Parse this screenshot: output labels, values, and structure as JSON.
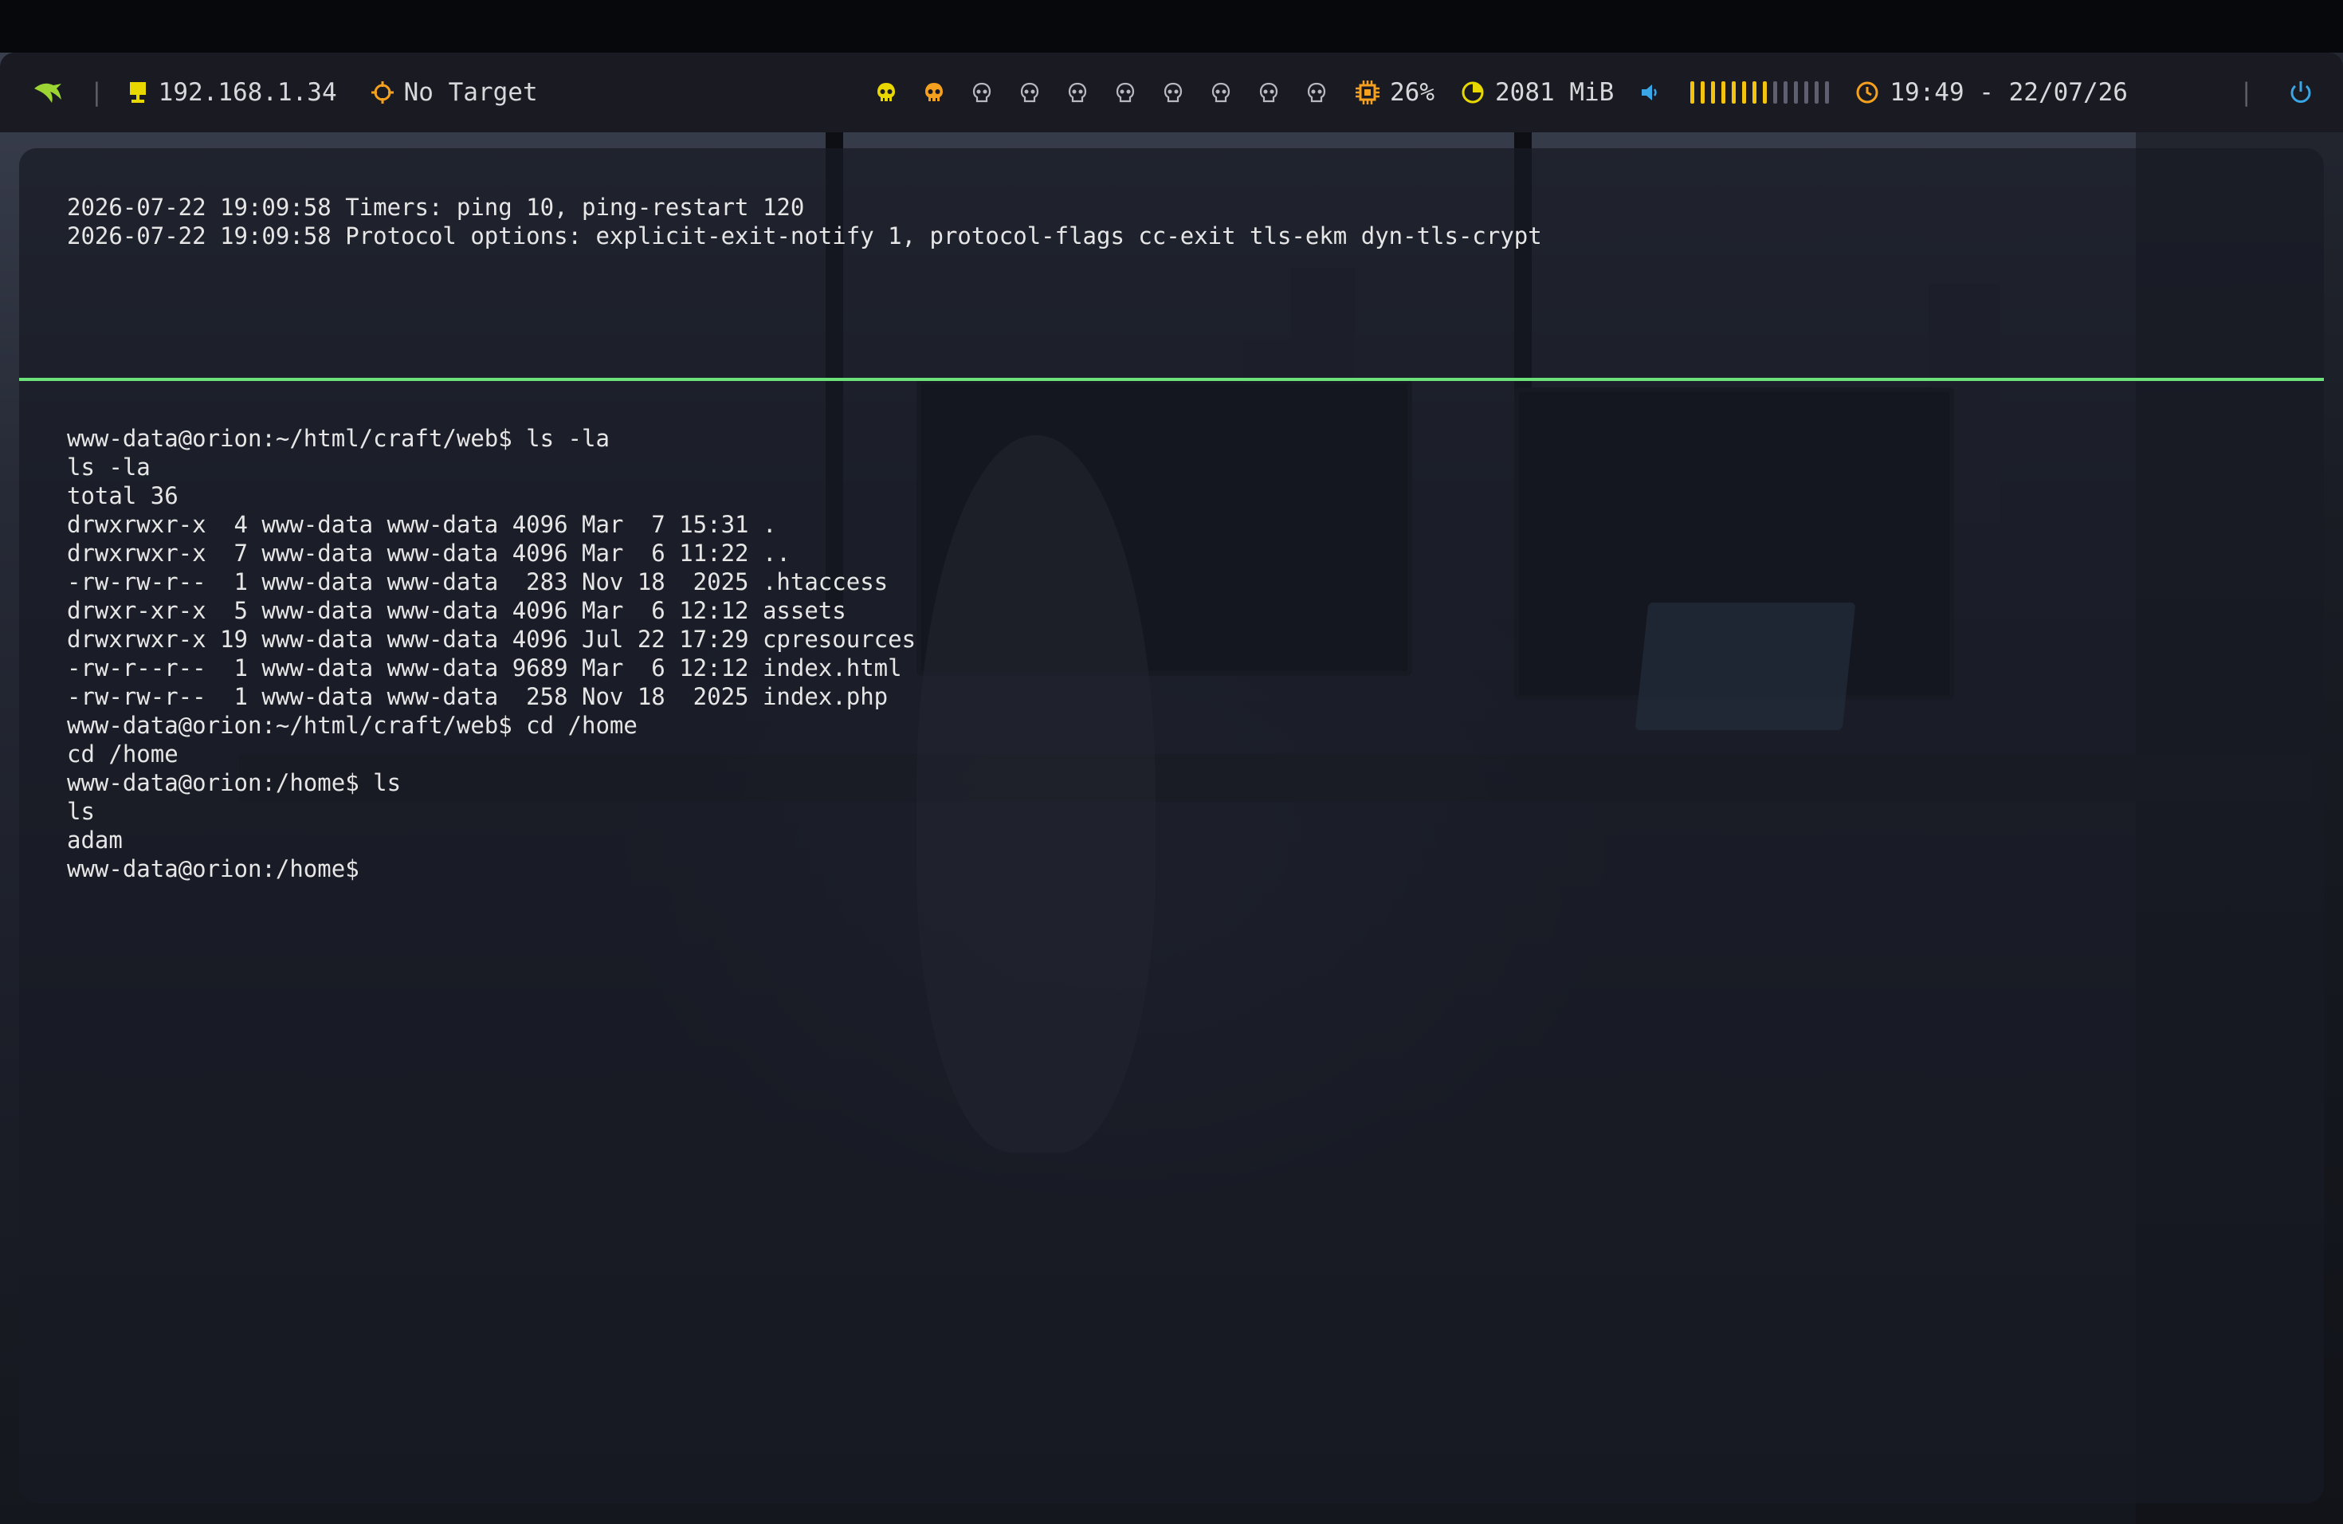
{
  "topbar": {
    "logo_icon": "dragon-logo-icon",
    "ip_icon": "monitor-ethernet-icon",
    "ip": "192.168.1.34",
    "target_icon": "crosshair-icon",
    "target": "No Target",
    "workspaces": [
      {
        "icon": "skull-icon",
        "color": "#e8d800",
        "active": true
      },
      {
        "icon": "skull-icon",
        "color": "#f5a01f",
        "active": true
      },
      {
        "icon": "skull-outline-icon",
        "color": "#b9bac0",
        "active": false
      },
      {
        "icon": "skull-outline-icon",
        "color": "#b9bac0",
        "active": false
      },
      {
        "icon": "skull-outline-icon",
        "color": "#b9bac0",
        "active": false
      },
      {
        "icon": "skull-outline-icon",
        "color": "#b9bac0",
        "active": false
      },
      {
        "icon": "skull-outline-icon",
        "color": "#b9bac0",
        "active": false
      },
      {
        "icon": "skull-outline-icon",
        "color": "#b9bac0",
        "active": false
      },
      {
        "icon": "skull-outline-icon",
        "color": "#b9bac0",
        "active": false
      },
      {
        "icon": "skull-outline-icon",
        "color": "#b9bac0",
        "active": false
      }
    ],
    "cpu_icon": "cpu-chip-icon",
    "cpu": "26%",
    "memory_icon": "memory-pie-icon",
    "memory": "2081 MiB",
    "volume_icon": "speaker-icon",
    "volume_level": 0.6,
    "clock_icon": "clock-icon",
    "datetime": "19:49 - 22/07/26",
    "power_icon": "power-icon",
    "colors": {
      "accent_yellow": "#f2c40f",
      "accent_orange": "#f5a01f",
      "accent_green": "#9bd433",
      "accent_blue": "#3aa6e6",
      "divider_green": "#6de27a"
    }
  },
  "terminal": {
    "top_pane": [
      "2026-07-22 19:09:58 Timers: ping 10, ping-restart 120",
      "2026-07-22 19:09:58 Protocol options: explicit-exit-notify 1, protocol-flags cc-exit tls-ekm dyn-tls-crypt"
    ],
    "bottom_pane": [
      "www-data@orion:~/html/craft/web$ ls -la",
      "ls -la",
      "total 36",
      "drwxrwxr-x  4 www-data www-data 4096 Mar  7 15:31 .",
      "drwxrwxr-x  7 www-data www-data 4096 Mar  6 11:22 ..",
      "-rw-rw-r--  1 www-data www-data  283 Nov 18  2025 .htaccess",
      "drwxr-xr-x  5 www-data www-data 4096 Mar  6 12:12 assets",
      "drwxrwxr-x 19 www-data www-data 4096 Jul 22 17:29 cpresources",
      "-rw-r--r--  1 www-data www-data 9689 Mar  6 12:12 index.html",
      "-rw-rw-r--  1 www-data www-data  258 Nov 18  2025 index.php",
      "www-data@orion:~/html/craft/web$ cd /home",
      "cd /home",
      "www-data@orion:/home$ ls",
      "ls",
      "adam",
      "www-data@orion:/home$"
    ]
  }
}
